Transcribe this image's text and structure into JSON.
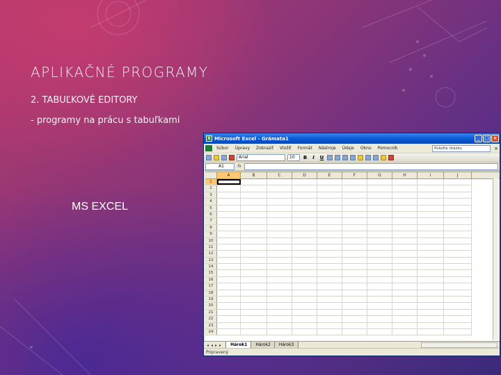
{
  "slide": {
    "title": "APLIKAČNÉ PROGRAMY",
    "subtitle": "2. TABUĽKOVÉ EDITORY",
    "description": "- programy na prácu s tabuľkami",
    "label": "MS EXCEL"
  },
  "excel": {
    "window_title": "Microsoft Excel - Grámata1",
    "menu": [
      "Súbor",
      "Úpravy",
      "Zobraziť",
      "Vložiť",
      "Formát",
      "Nástroje",
      "Údaje",
      "Okno",
      "Pomocník"
    ],
    "help_placeholder": "Položte otázku",
    "font_name": "Arial",
    "font_size": "10",
    "name_box": "A1",
    "columns": [
      "A",
      "B",
      "C",
      "D",
      "E",
      "F",
      "G",
      "H",
      "I",
      "J"
    ],
    "row_numbers": [
      "1",
      "2",
      "3",
      "4",
      "5",
      "6",
      "7",
      "8",
      "9",
      "10",
      "11",
      "12",
      "13",
      "14",
      "15",
      "16",
      "17",
      "18",
      "19",
      "20",
      "21",
      "22",
      "23",
      "24"
    ],
    "sheets": [
      "Hárok1",
      "Hárok2",
      "Hárok3"
    ],
    "status": "Pripravený"
  }
}
